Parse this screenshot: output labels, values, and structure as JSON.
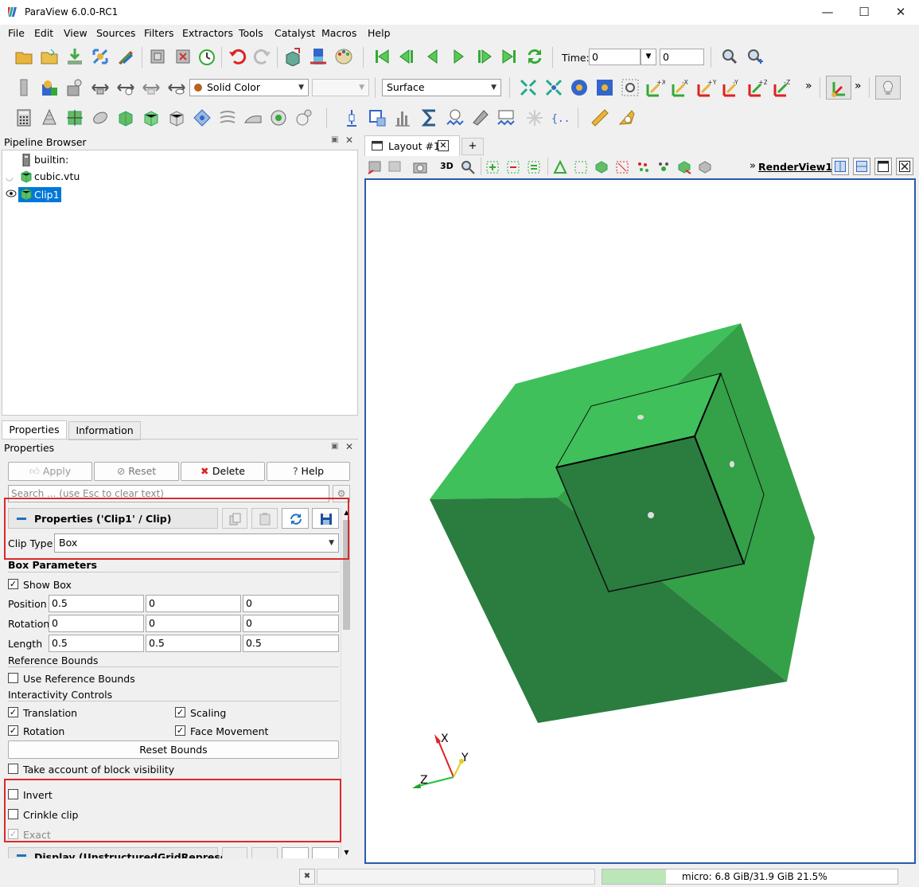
{
  "window": {
    "title": "ParaView 6.0.0-RC1",
    "minimize": "—",
    "maximize": "☐",
    "close": "✕"
  },
  "menu": [
    "File",
    "Edit",
    "View",
    "Sources",
    "Filters",
    "Extractors",
    "Tools",
    "Catalyst",
    "Macros",
    "Help"
  ],
  "time": {
    "label": "Time:",
    "value": "0",
    "index": "0"
  },
  "toolbar2": {
    "coloring": "Solid Color",
    "component": "",
    "representation": "Surface",
    "more": "»"
  },
  "pipeline": {
    "title": "Pipeline Browser",
    "items": [
      {
        "name": "builtin:"
      },
      {
        "name": "cubic.vtu"
      },
      {
        "name": "Clip1"
      }
    ]
  },
  "props_tabs": [
    "Properties",
    "Information"
  ],
  "props": {
    "title": "Properties",
    "apply": "Apply",
    "reset": "Reset",
    "delete": "Delete",
    "help": "Help",
    "search_placeholder": "Search ... (use Esc to clear text)",
    "section_title": "Properties ('Clip1' / Clip)",
    "clip_type_label": "Clip Type",
    "clip_type_value": "Box",
    "box_params": "Box Parameters",
    "show_box": "Show Box",
    "position_label": "Position",
    "position": [
      "0.5",
      "0",
      "0"
    ],
    "rotation_label": "Rotation",
    "rotation": [
      "0",
      "0",
      "0"
    ],
    "length_label": "Length",
    "length": [
      "0.5",
      "0.5",
      "0.5"
    ],
    "ref_bounds": "Reference Bounds",
    "use_ref_bounds": "Use Reference Bounds",
    "interactivity": "Interactivity Controls",
    "translation": "Translation",
    "scaling": "Scaling",
    "rotation_cb": "Rotation",
    "face_movement": "Face Movement",
    "reset_bounds": "Reset Bounds",
    "block_visibility": "Take account of block visibility",
    "invert": "Invert",
    "crinkle": "Crinkle clip",
    "exact": "Exact",
    "display_title": "Display (UnstructuredGridRepresent"
  },
  "layout": {
    "tab": "Layout #1",
    "close": "✕",
    "add": "+",
    "view3d": "3D",
    "render_view": "RenderView1",
    "more": "»"
  },
  "axes": {
    "x": "X",
    "y": "Y",
    "z": "Z"
  },
  "status": {
    "memory": "micro: 6.8 GiB/31.9 GiB 21.5%",
    "memory_fraction": 0.215
  },
  "colors": {
    "cube_front": "#2a7d3f",
    "cube_top": "#3fc05a",
    "cube_right": "#34a048",
    "selection": "#0078d7",
    "highlight": "#d92a2a"
  }
}
